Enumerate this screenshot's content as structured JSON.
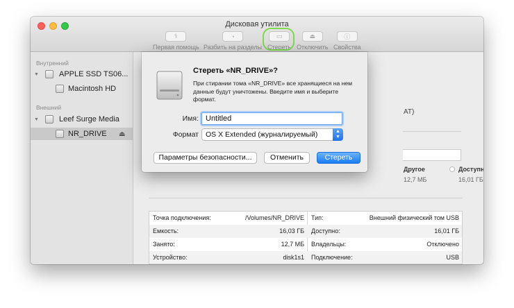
{
  "window": {
    "title": "Дисковая утилита"
  },
  "toolbar": {
    "first_aid": "Первая помощь",
    "partition": "Разбить на разделы",
    "erase": "Стереть",
    "unmount": "Отключить",
    "info": "Свойства"
  },
  "sidebar": {
    "internal_header": "Внутренний",
    "external_header": "Внешний",
    "items": [
      {
        "label": "APPLE SSD TS06..."
      },
      {
        "label": "Macintosh HD"
      },
      {
        "label": "Leef Surge Media"
      },
      {
        "label": "NR_DRIVE"
      }
    ]
  },
  "main": {
    "fragment_at": "AT)",
    "legend": {
      "other_label": "Другое",
      "other_value": "12,7 МБ",
      "free_label": "Доступно",
      "free_value": "16,01 ГБ"
    },
    "info": {
      "rows": [
        {
          "k1": "Точка подключения:",
          "v1": "/Volumes/NR_DRIVE",
          "k2": "Тип:",
          "v2": "Внешний физический том USB"
        },
        {
          "k1": "Емкость:",
          "v1": "16,03 ГБ",
          "k2": "Доступно:",
          "v2": "16,01 ГБ"
        },
        {
          "k1": "Занято:",
          "v1": "12,7 МБ",
          "k2": "Владельцы:",
          "v2": "Отключено"
        },
        {
          "k1": "Устройство:",
          "v1": "disk1s1",
          "k2": "Подключение:",
          "v2": "USB"
        }
      ]
    }
  },
  "sheet": {
    "title": "Стереть «NR_DRIVE»?",
    "description": "При стирании тома «NR_DRIVE» все хранящиеся на нем данные будут уничтожены. Введите имя и выберите формат.",
    "name_label": "Имя:",
    "name_value": "Untitled",
    "format_label": "Формат",
    "format_value": "OS X Extended (журналируемый)",
    "security_button": "Параметры безопасности...",
    "cancel_button": "Отменить",
    "erase_button": "Стереть"
  },
  "colors": {
    "accent": "#1a7cf3",
    "highlight_ring": "#7ed94d"
  }
}
